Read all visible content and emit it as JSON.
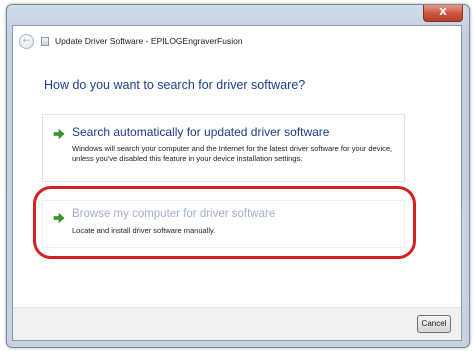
{
  "window": {
    "title": "",
    "close_label": "X"
  },
  "nav": {
    "back_label": "←",
    "wizard_title": "Update Driver Software - EPILOGEngraverFusion"
  },
  "main": {
    "heading": "How do you want to search for driver software?",
    "options": [
      {
        "title": "Search automatically for updated driver software",
        "description": "Windows will search your computer and the Internet for the latest driver software for your device, unless you've disabled this feature in your device installation settings."
      },
      {
        "title": "Browse my computer for driver software",
        "description": "Locate and install driver software manually."
      }
    ]
  },
  "footer": {
    "cancel_label": "Cancel"
  },
  "colors": {
    "accent_green": "#3a9a2e",
    "link_blue": "#1a3c86",
    "highlight_red": "#d42020"
  },
  "icons": {
    "option_arrow": "green-arrow-icon"
  }
}
